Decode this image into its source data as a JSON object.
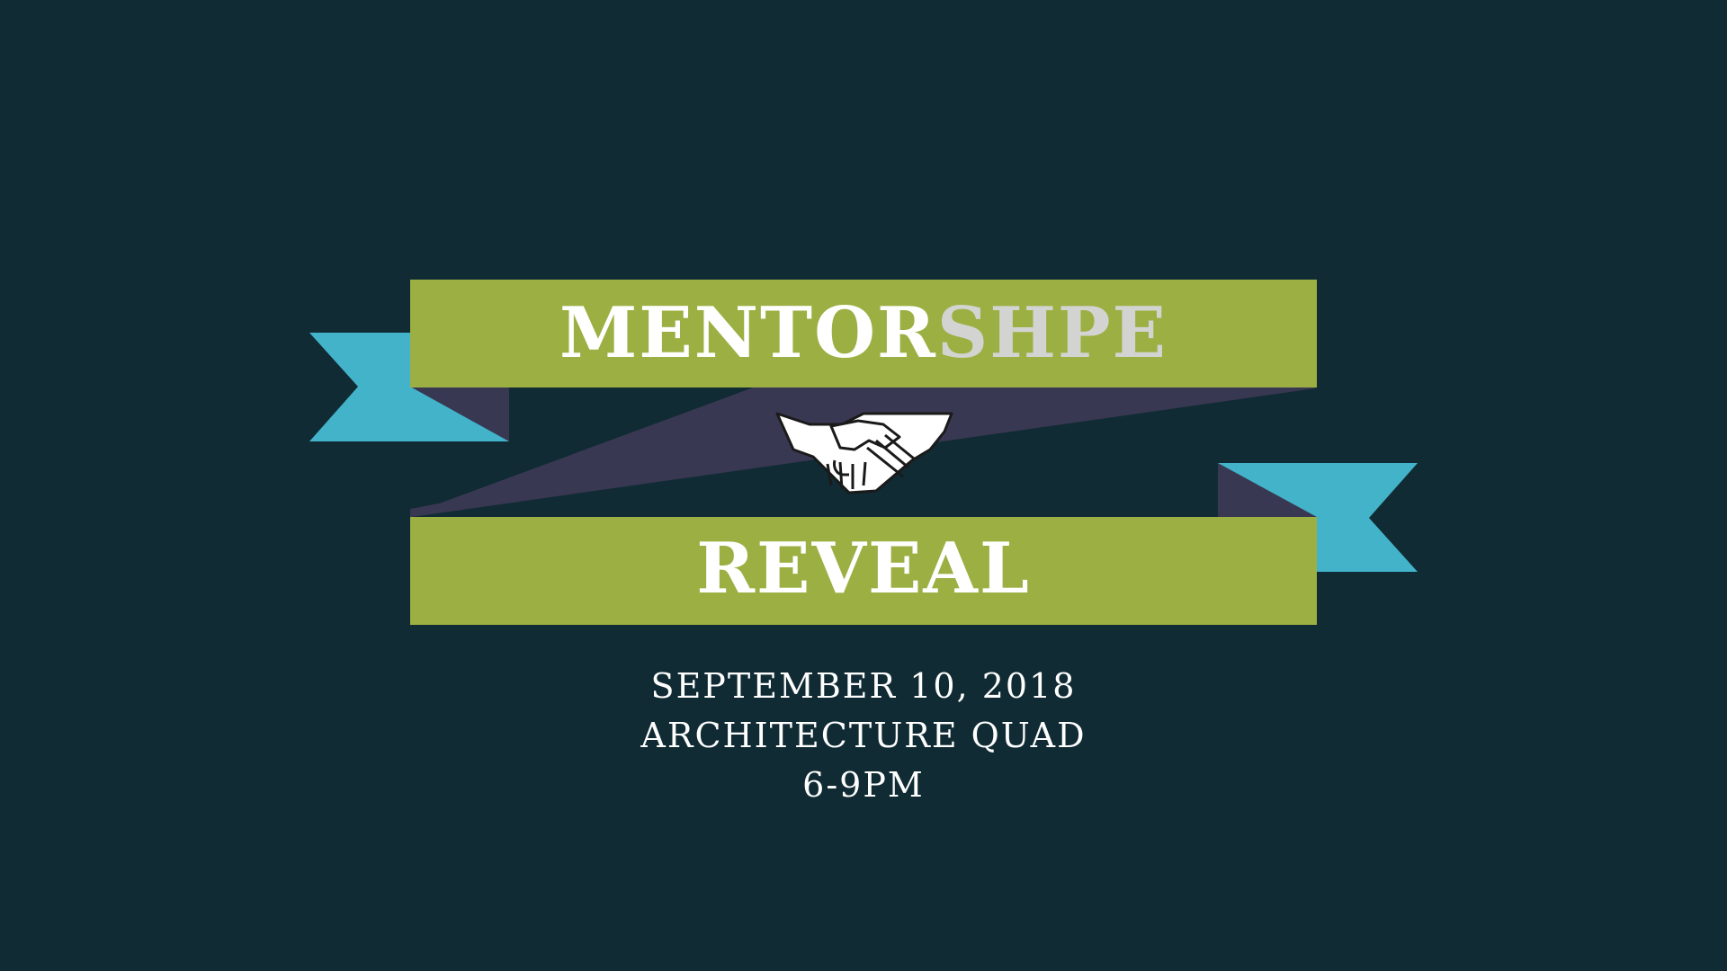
{
  "colors": {
    "background": "#102b33",
    "ribbon_green": "#9caf43",
    "ribbon_fold": "#393853",
    "ribbon_tail": "#43b3c9",
    "title_text": "#ffffff",
    "title_accent_text": "#d3d4d1"
  },
  "banner": {
    "title_part1": "MENTOR",
    "title_part2": "SHPE",
    "subtitle": "REVEAL",
    "icon": "handshake-icon"
  },
  "event": {
    "date": "SEPTEMBER 10, 2018",
    "location": "ARCHITECTURE QUAD",
    "time": "6-9PM"
  }
}
